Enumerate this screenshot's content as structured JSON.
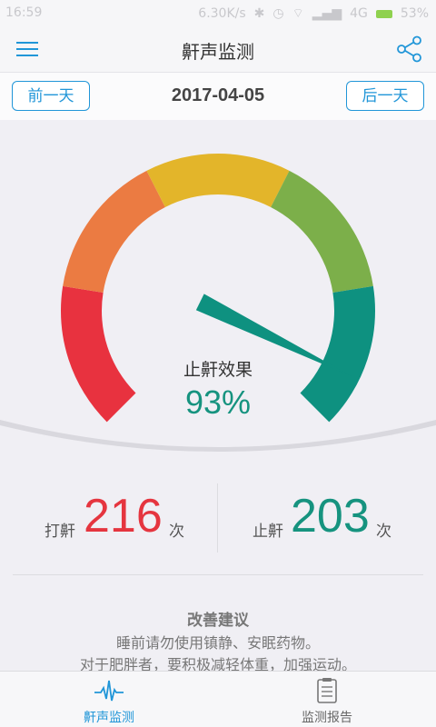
{
  "status_bar": {
    "time": "16:59",
    "net_speed": "6.30K/s",
    "signal": "4G",
    "battery": "53%"
  },
  "app_bar": {
    "title": "鼾声监测",
    "menu_icon": "hamburger-menu-icon",
    "share_icon": "share-icon"
  },
  "date_nav": {
    "prev_label": "前一天",
    "date": "2017-04-05",
    "next_label": "后一天"
  },
  "gauge": {
    "label": "止鼾效果",
    "value_text": "93%",
    "value": 0.93,
    "colors": [
      "#e8323f",
      "#eb7b42",
      "#e3b52a",
      "#7caf4a",
      "#0e9180"
    ]
  },
  "stats": {
    "snore": {
      "label": "打鼾",
      "value": "216",
      "unit": "次",
      "color": "#e5353f"
    },
    "stopped": {
      "label": "止鼾",
      "value": "203",
      "unit": "次",
      "color": "#16937f"
    }
  },
  "advice": {
    "title": "改善建议",
    "lines": [
      "睡前请勿使用镇静、安眠药物。",
      "对于肥胖者，要积极减轻体重，加强运动。"
    ]
  },
  "tabs": [
    {
      "label": "鼾声监测",
      "icon": "waveform-icon",
      "active": true
    },
    {
      "label": "监测报告",
      "icon": "clipboard-icon",
      "active": false
    }
  ]
}
